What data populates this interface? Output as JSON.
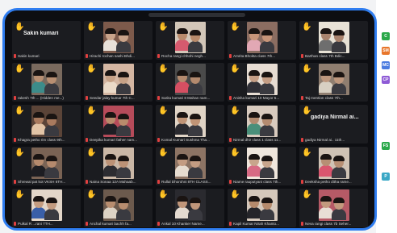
{
  "meeting": {
    "tiles": [
      {
        "label": "Sakin kumari",
        "big": "Sakin kumari",
        "photo": false
      },
      {
        "label": "Hirachi rochan sashi Bhdi...",
        "big": "",
        "photo": true,
        "tones": [
          "#c9a38a",
          "#e8e0d8",
          "#7d5a4b"
        ]
      },
      {
        "label": "Rocha rangi chhohi negh...",
        "big": "",
        "photo": true,
        "tones": [
          "#b88a6b",
          "#d65a6e",
          "#d2c6b8"
        ]
      },
      {
        "label": "Amrita Bhokta class 7th...",
        "big": "",
        "photo": true,
        "tones": [
          "#c79579",
          "#e2a8b4",
          "#8b6d61"
        ]
      },
      {
        "label": "Barthan class 7th Bdic...",
        "big": "",
        "photo": true,
        "tones": [
          "#a9836d",
          "#6e6e6e",
          "#e8e2d6"
        ]
      },
      {
        "label": "rakesh 7th ... (Hidden me...)",
        "big": "",
        "photo": true,
        "tones": [
          "#b88f72",
          "#3c8c8a",
          "#7a6a5e"
        ]
      },
      {
        "label": "Seedar jalay kumar 7th C...",
        "big": "",
        "photo": true,
        "tones": [
          "#c6a186",
          "#ead9c7",
          "#d4b6a2"
        ]
      },
      {
        "label": "Sarita kumari 8 Mahan nam...",
        "big": "",
        "photo": true,
        "tones": [
          "#b48a6e",
          "#d54f62",
          "#4a4a4a"
        ]
      },
      {
        "label": "Anisha kumari 10 Mayor 5...",
        "big": "",
        "photo": true,
        "tones": [
          "#c59e85",
          "#2f2f36",
          "#e6dcd2"
        ]
      },
      {
        "label": "Taj mention class 7th...",
        "big": "",
        "photo": true,
        "tones": [
          "#bd977d",
          "#d8d0c2",
          "#8f7e70"
        ]
      },
      {
        "label": "Khagra petho rim class 9th...",
        "big": "",
        "photo": true,
        "tones": [
          "#a97a5e",
          "#e2c4a6",
          "#5b4438"
        ]
      },
      {
        "label": "Deepika kumari father nam...",
        "big": "",
        "photo": true,
        "tones": [
          "#b88b6c",
          "#1e1e24",
          "#b64b5a"
        ]
      },
      {
        "label": "Komal Kumari Sushma Tha...",
        "big": "",
        "photo": true,
        "tones": [
          "#c09476",
          "#2a2a2f",
          "#e0d4c6"
        ]
      },
      {
        "label": "Nirmal dhir class 1 class 11...",
        "big": "",
        "photo": true,
        "tones": [
          "#b38b70",
          "#4a8f7a",
          "#d8cabe"
        ]
      },
      {
        "label": "gadiya Nirmal ai.. 11th...",
        "big": "gadiya Nirmal ai...",
        "photo": false
      },
      {
        "label": "Shrewal pat kot VKSH 6TH...",
        "big": "",
        "photo": true,
        "tones": [
          "#b58a6d",
          "#1d1d22",
          "#7a6354"
        ]
      },
      {
        "label": "Naina Sonaa 12A Mahaab...",
        "big": "",
        "photo": true,
        "tones": [
          "#bc9276",
          "#2c2c31",
          "#cab7a6"
        ]
      },
      {
        "label": "Rullal Dhorohni 8TH CLASS...",
        "big": "",
        "photo": true,
        "tones": [
          "#c39c82",
          "#e6dcd0",
          "#8d7464"
        ]
      },
      {
        "label": "Niame rauputyani class 7th...",
        "big": "",
        "photo": true,
        "tones": [
          "#c8a58c",
          "#d76a84",
          "#efe6dc"
        ]
      },
      {
        "label": "Deeksha petho ditha rame...",
        "big": "",
        "photo": true,
        "tones": [
          "#b78f74",
          "#d9566e",
          "#cfc2b4"
        ]
      },
      {
        "label": "Pulkal R ...rani 7TH...",
        "big": "",
        "photo": true,
        "tones": [
          "#c49c80",
          "#3a5fa8",
          "#e3d6c8"
        ]
      },
      {
        "label": "Anchal kumari bachh fa...",
        "big": "",
        "photo": true,
        "tones": [
          "#b88d6f",
          "#dcd2c4",
          "#6c5a4d"
        ]
      },
      {
        "label": "Ankal 10 Khanker Name...",
        "big": "",
        "photo": true,
        "tones": [
          "#c0967a",
          "#e4dad0",
          "#2a2a2f"
        ]
      },
      {
        "label": "Kapil Kumar Nirah Khanto...",
        "big": "",
        "photo": true,
        "tones": [
          "#b58a6c",
          "#25252a",
          "#d5c8bb"
        ]
      },
      {
        "label": "Neva rangi class 7b Seher...",
        "big": "",
        "photo": true,
        "tones": [
          "#c39a7e",
          "#e8dfd5",
          "#b65a66"
        ]
      }
    ]
  },
  "sidebar": {
    "buttons": [
      {
        "text": "C",
        "color": "#2aa84a"
      },
      {
        "text": "SM",
        "color": "#e8762b"
      },
      {
        "text": "MC",
        "color": "#4b7be0"
      },
      {
        "text": "CP",
        "color": "#8e5bd6"
      },
      {
        "text": "FS",
        "color": "#2aa84a"
      },
      {
        "text": "P",
        "color": "#3aa8c6"
      }
    ]
  },
  "icons": {
    "raised_hand": "raised-hand-icon",
    "mic_muted": "mic-muted-icon"
  }
}
